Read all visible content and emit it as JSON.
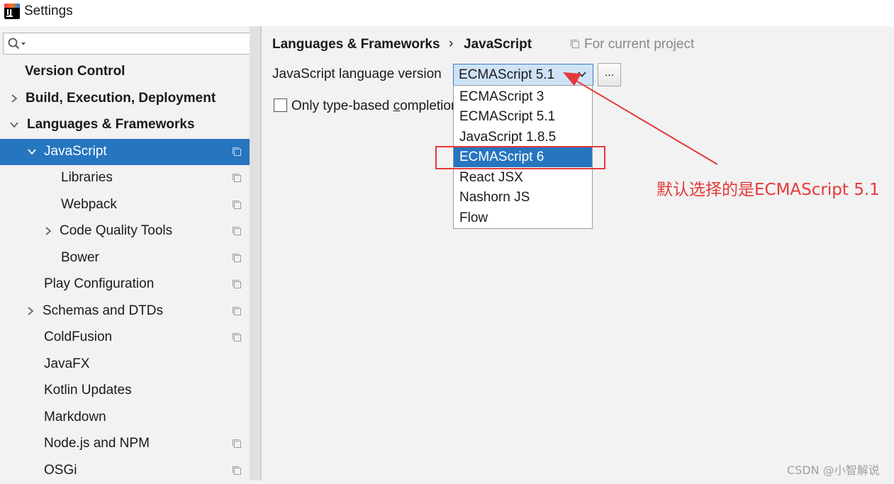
{
  "window": {
    "title": "Settings",
    "app_icon": "intellij-idea-icon"
  },
  "search": {
    "value": "",
    "icon": "search-icon"
  },
  "sidebar": {
    "items": [
      {
        "label": "Version Control",
        "bold": true,
        "arrow": "none"
      },
      {
        "label": "Build, Execution, Deployment",
        "bold": true,
        "arrow": "right"
      },
      {
        "label": "Languages & Frameworks",
        "bold": true,
        "arrow": "down"
      },
      {
        "label": "JavaScript",
        "selected": true,
        "arrow": "down",
        "project_icon": true
      },
      {
        "label": "Libraries",
        "project_icon": true
      },
      {
        "label": "Webpack",
        "project_icon": true
      },
      {
        "label": "Code Quality Tools",
        "arrow": "right",
        "project_icon": true
      },
      {
        "label": "Bower",
        "project_icon": true
      },
      {
        "label": "Play Configuration",
        "project_icon": true
      },
      {
        "label": "Schemas and DTDs",
        "arrow": "right",
        "project_icon": true
      },
      {
        "label": "ColdFusion",
        "project_icon": true
      },
      {
        "label": "JavaFX"
      },
      {
        "label": "Kotlin Updates"
      },
      {
        "label": "Markdown"
      },
      {
        "label": "Node.js and NPM",
        "project_icon": true
      },
      {
        "label": "OSGi",
        "project_icon": true
      }
    ]
  },
  "breadcrumb": {
    "parent": "Languages & Frameworks",
    "separator": "›",
    "current": "JavaScript",
    "scope_label": "For current project"
  },
  "settings": {
    "language_version_label": "JavaScript language version",
    "language_version_value": "ECMAScript 5.1",
    "browse_button_label": "...",
    "checkbox_label_prefix": "Only type-based ",
    "checkbox_label_mnemonic": "c",
    "checkbox_label_rest": "ompletion",
    "checkbox_checked": false
  },
  "dropdown": {
    "options": [
      "ECMAScript 3",
      "ECMAScript 5.1",
      "JavaScript 1.8.5",
      "ECMAScript 6",
      "React JSX",
      "Nashorn JS",
      "Flow"
    ],
    "highlighted": "ECMAScript 6"
  },
  "annotation": {
    "text": "默认选择的是ECMAScript 5.1",
    "color": "#e5393a"
  },
  "watermark": "CSDN @小智解说",
  "colors": {
    "selection": "#2675bf",
    "background": "#f2f2f2",
    "annotation": "#e5393a"
  }
}
